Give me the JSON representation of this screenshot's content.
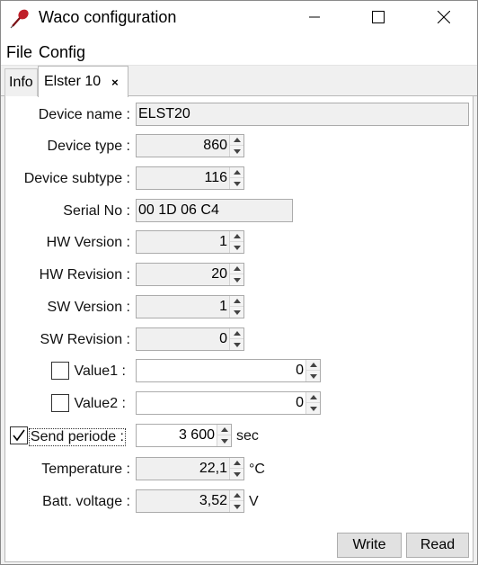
{
  "window": {
    "title": "Waco configuration",
    "icon": "pin-icon",
    "accent_color": "#c0202a"
  },
  "menu": {
    "file": "File",
    "config": "Config"
  },
  "tabs": [
    {
      "label": "Info",
      "active": false
    },
    {
      "label": "Elster 10",
      "active": true,
      "close_glyph": "×"
    }
  ],
  "fields": {
    "device_name": {
      "label": "Device name :",
      "value": "ELST20"
    },
    "device_type": {
      "label": "Device type :",
      "value": "860"
    },
    "device_subtype": {
      "label": "Device subtype :",
      "value": "116"
    },
    "serial_no": {
      "label": "Serial No :",
      "value": "00 1D 06 C4"
    },
    "hw_version": {
      "label": "HW Version :",
      "value": "1"
    },
    "hw_revision": {
      "label": "HW Revision :",
      "value": "20"
    },
    "sw_version": {
      "label": "SW Version :",
      "value": "1"
    },
    "sw_revision": {
      "label": "SW Revision :",
      "value": "0"
    },
    "value1": {
      "label": "Value1 :",
      "value": "0",
      "checked": false
    },
    "value2": {
      "label": "Value2 :",
      "value": "0",
      "checked": false
    },
    "send_periode": {
      "label": "Send periode :",
      "value": "3 600",
      "unit": "sec",
      "checked": true
    },
    "temperature": {
      "label": "Temperature :",
      "value": "22,1",
      "unit": "°C"
    },
    "batt_voltage": {
      "label": "Batt. voltage :",
      "value": "3,52",
      "unit": "V"
    }
  },
  "buttons": {
    "write": "Write",
    "read": "Read"
  }
}
